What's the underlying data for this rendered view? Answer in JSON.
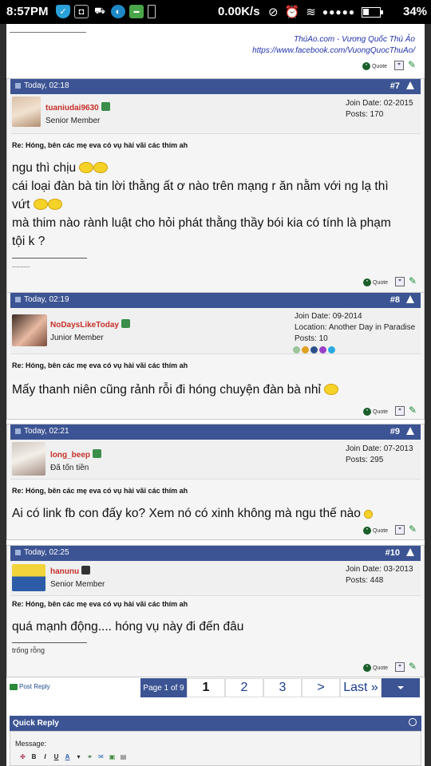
{
  "status_bar": {
    "time": "8:57PM",
    "speed": "0.00K/s",
    "battery": "34%",
    "battery_level": 0.34
  },
  "signature_top": {
    "line1": "ThúAo.com - Vương Quốc Thú Ảo",
    "line2": "https://www.facebook.com/VuongQuocThuAo/"
  },
  "quote_label": "Quote",
  "posts": [
    {
      "date": "Today, 02:18",
      "number": "#7",
      "username": "tuaniudai9630",
      "user_title": "Senior Member",
      "join_date": "Join Date: 02-2015",
      "location": "",
      "posts": "Posts: 170",
      "title": "Re: Hóng, bên các mẹ eva có vụ hài vãi các thím ah",
      "body": [
        "ngu thì chịu",
        "cái loại đàn bà tin lời thằng ất ơ nào trên mạng r ăn nằm với ng lạ thì",
        "vứt",
        "mà thim nào rành luật cho hỏi phát thằng thầy bói kia có tính là phạm",
        "tội k ?"
      ],
      "signature": "........."
    },
    {
      "date": "Today, 02:19",
      "number": "#8",
      "username": "NoDaysLikeToday",
      "user_title": "Junior Member",
      "join_date": "Join Date: 09-2014",
      "location": "Location: Another Day in Paradise",
      "posts": "Posts: 10",
      "title": "Re: Hóng, bên các mẹ eva có vụ hài vãi các thím ah",
      "body": [
        "Mấy thanh niên cũng rảnh rỗi đi hóng chuyện đàn bà nhỉ"
      ],
      "signature": ""
    },
    {
      "date": "Today, 02:21",
      "number": "#9",
      "username": "long_beep",
      "user_title": "Đã tốn tiền",
      "join_date": "Join Date: 07-2013",
      "location": "",
      "posts": "Posts: 295",
      "title": "Re: Hóng, bên các mẹ eva có vụ hài vãi các thím ah",
      "body": [
        "Ai có link fb con đấy ko? Xem nó có xinh không mà ngu thế nào"
      ],
      "signature": ""
    },
    {
      "date": "Today, 02:25",
      "number": "#10",
      "username": "hanunu",
      "user_title": "Senior Member",
      "join_date": "Join Date: 03-2013",
      "location": "",
      "posts": "Posts: 448",
      "title": "Re: Hóng, bên các mẹ eva có vụ hài vãi các thím ah",
      "body": [
        "quá mạnh động.... hóng vụ này đi đến đâu"
      ],
      "signature": "trống rỗng"
    }
  ],
  "post_reply": "Post Reply",
  "pagination": {
    "info": "Page 1 of 9",
    "current": "1",
    "p2": "2",
    "p3": "3",
    "next": ">",
    "last": "Last »"
  },
  "quick_reply": {
    "title": "Quick Reply",
    "message_label": "Message:"
  },
  "toolbar": {
    "bold": "B",
    "italic": "I",
    "underline": "U",
    "color": "A"
  }
}
